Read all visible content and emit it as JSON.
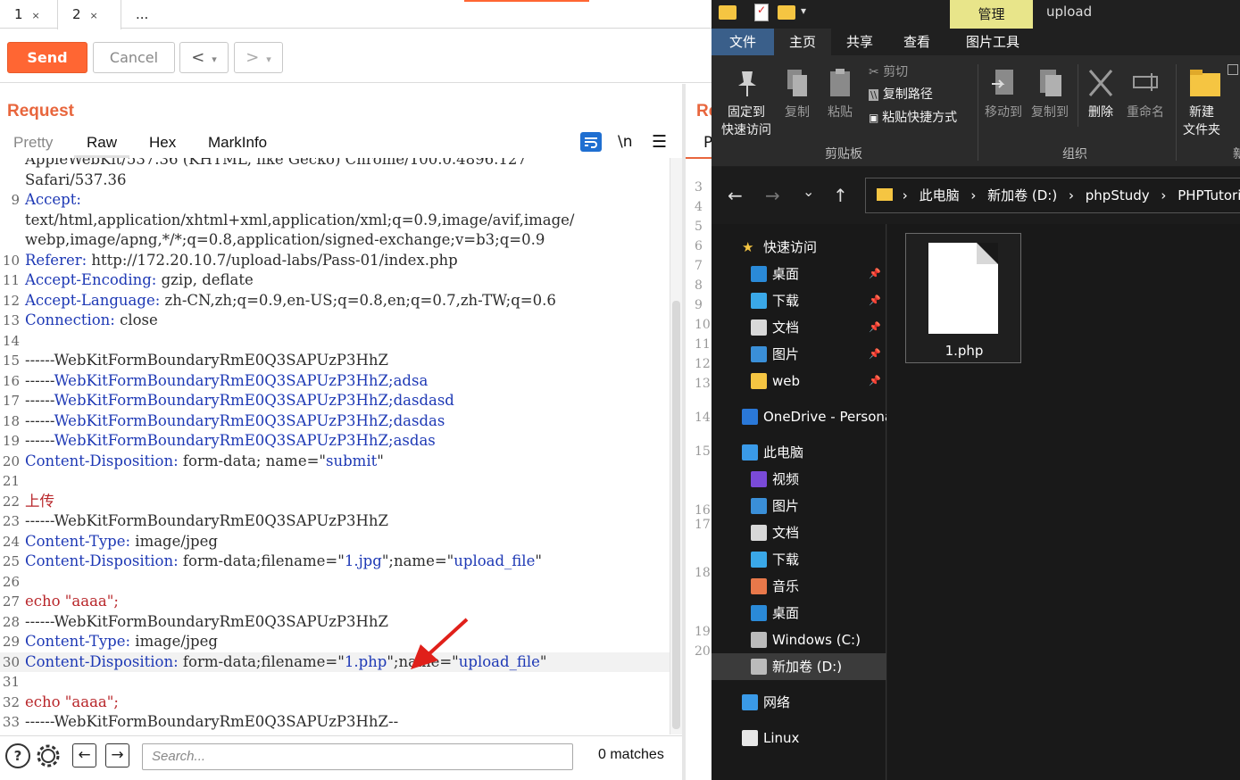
{
  "burp": {
    "tabs": [
      "1",
      "2",
      "..."
    ],
    "tab_close": "×",
    "buttons": {
      "send": "Send",
      "cancel": "Cancel",
      "back": "<",
      "forward": ">",
      "dropdown": "▾"
    },
    "request_title": "Request",
    "response_title": "Re",
    "view_tabs": [
      "Pretty",
      "Raw",
      "Hex",
      "MarkInfo"
    ],
    "newline_toggle": "\\n",
    "lines": [
      {
        "n": "",
        "parts": [
          [
            "v",
            "AppleWebKit/537.36 (KHTML, like Gecko) Chrome/100.0.4896.127"
          ]
        ]
      },
      {
        "n": "",
        "parts": [
          [
            "v",
            "Safari/537.36"
          ]
        ]
      },
      {
        "n": "9",
        "parts": [
          [
            "k",
            "Accept:"
          ]
        ]
      },
      {
        "n": "",
        "parts": [
          [
            "v",
            "text/html,application/xhtml+xml,application/xml;q=0.9,image/avif,image/"
          ]
        ]
      },
      {
        "n": "",
        "parts": [
          [
            "v",
            "webp,image/apng,*/*;q=0.8,application/signed-exchange;v=b3;q=0.9"
          ]
        ]
      },
      {
        "n": "10",
        "parts": [
          [
            "k",
            "Referer:"
          ],
          [
            "v",
            " http://172.20.10.7/upload-labs/Pass-01/index.php"
          ]
        ]
      },
      {
        "n": "11",
        "parts": [
          [
            "k",
            "Accept-Encoding:"
          ],
          [
            "v",
            " gzip, deflate"
          ]
        ]
      },
      {
        "n": "12",
        "parts": [
          [
            "k",
            "Accept-Language:"
          ],
          [
            "v",
            " zh-CN,zh;q=0.9,en-US;q=0.8,en;q=0.7,zh-TW;q=0.6"
          ]
        ]
      },
      {
        "n": "13",
        "parts": [
          [
            "k",
            "Connection:"
          ],
          [
            "v",
            " close"
          ]
        ]
      },
      {
        "n": "14",
        "parts": []
      },
      {
        "n": "15",
        "parts": [
          [
            "v",
            "------WebKitFormBoundaryRmE0Q3SAPUzP3HhZ"
          ]
        ]
      },
      {
        "n": "16",
        "parts": [
          [
            "v",
            "------"
          ],
          [
            "k",
            "WebKitFormBoundaryRmE0Q3SAPUzP3HhZ;adsa"
          ]
        ]
      },
      {
        "n": "17",
        "parts": [
          [
            "v",
            "------"
          ],
          [
            "k",
            "WebKitFormBoundaryRmE0Q3SAPUzP3HhZ;dasdasd"
          ]
        ]
      },
      {
        "n": "18",
        "parts": [
          [
            "v",
            "------"
          ],
          [
            "k",
            "WebKitFormBoundaryRmE0Q3SAPUzP3HhZ;dasdas"
          ]
        ]
      },
      {
        "n": "19",
        "parts": [
          [
            "v",
            "------"
          ],
          [
            "k",
            "WebKitFormBoundaryRmE0Q3SAPUzP3HhZ;asdas"
          ]
        ]
      },
      {
        "n": "20",
        "parts": [
          [
            "k",
            "Content-Disposition:"
          ],
          [
            "v",
            " form-data; name=\""
          ],
          [
            "k",
            "submit"
          ],
          [
            "v",
            "\""
          ]
        ]
      },
      {
        "n": "21",
        "parts": []
      },
      {
        "n": "22",
        "parts": [
          [
            "r",
            "上传"
          ]
        ]
      },
      {
        "n": "23",
        "parts": [
          [
            "v",
            "------WebKitFormBoundaryRmE0Q3SAPUzP3HhZ"
          ]
        ]
      },
      {
        "n": "24",
        "parts": [
          [
            "k",
            "Content-Type:"
          ],
          [
            "v",
            " image/jpeg"
          ]
        ]
      },
      {
        "n": "25",
        "parts": [
          [
            "k",
            "Content-Disposition:"
          ],
          [
            "v",
            " form-data;filename=\""
          ],
          [
            "k",
            "1.jpg"
          ],
          [
            "v",
            "\";name=\""
          ],
          [
            "k",
            "upload_file"
          ],
          [
            "v",
            "\""
          ]
        ]
      },
      {
        "n": "26",
        "parts": []
      },
      {
        "n": "27",
        "parts": [
          [
            "r",
            "echo \"aaaa\";"
          ]
        ]
      },
      {
        "n": "28",
        "parts": [
          [
            "v",
            "------WebKitFormBoundaryRmE0Q3SAPUzP3HhZ"
          ]
        ]
      },
      {
        "n": "29",
        "parts": [
          [
            "k",
            "Content-Type:"
          ],
          [
            "v",
            " image/jpeg"
          ]
        ]
      },
      {
        "n": "30",
        "parts": [
          [
            "k",
            "Content-Disposition:"
          ],
          [
            "v",
            " form-data;filename=\""
          ],
          [
            "k",
            "1.php"
          ],
          [
            "v",
            "\";name=\""
          ],
          [
            "k",
            "upload_file"
          ],
          [
            "v",
            "\""
          ]
        ],
        "highlight": true
      },
      {
        "n": "31",
        "parts": []
      },
      {
        "n": "32",
        "parts": [
          [
            "r",
            "echo \"aaaa\";"
          ]
        ]
      },
      {
        "n": "33",
        "parts": [
          [
            "v",
            "------WebKitFormBoundaryRmE0Q3SAPUzP3HhZ--"
          ]
        ]
      }
    ],
    "response_line_numbers": [
      "3",
      "4",
      "5",
      "6",
      "7",
      "8",
      "9",
      "10",
      "11",
      "12",
      "13",
      "14",
      "15",
      "16",
      "17",
      "18",
      "19",
      "20"
    ],
    "search_placeholder": "Search...",
    "matches": "0 matches",
    "accent_color": "#ff6633"
  },
  "explorer": {
    "context_tab": "管理",
    "window_title": "upload",
    "ribbon_tabs": [
      "文件",
      "主页",
      "共享",
      "查看",
      "图片工具"
    ],
    "ribbon": {
      "pin": "固定到\n快速访问",
      "copy": "复制",
      "paste": "粘贴",
      "cut": "剪切",
      "copy_path": "复制路径",
      "paste_shortcut": "粘贴快捷方式",
      "move_to": "移动到",
      "copy_to": "复制到",
      "delete": "删除",
      "rename": "重命名",
      "new_folder": "新建\n文件夹",
      "group_clipboard": "剪贴板",
      "group_organize": "组织",
      "group_new": "新"
    },
    "path": [
      "此电脑",
      "新加卷 (D:)",
      "phpStudy",
      "PHPTutorial"
    ],
    "path_sep": "›",
    "nav": {
      "back": "←",
      "forward": "→",
      "recent": "⌄",
      "up": "↑"
    },
    "tree": [
      {
        "label": "快速访问",
        "icon": "star-icon",
        "level": 0
      },
      {
        "label": "桌面",
        "icon": "desktop-icon",
        "level": 1,
        "pinned": true
      },
      {
        "label": "下载",
        "icon": "download-icon",
        "level": 1,
        "pinned": true
      },
      {
        "label": "文档",
        "icon": "document-icon",
        "level": 1,
        "pinned": true
      },
      {
        "label": "图片",
        "icon": "picture-icon",
        "level": 1,
        "pinned": true
      },
      {
        "label": "web",
        "icon": "folder-icon",
        "level": 1,
        "pinned": true
      },
      {
        "label": "OneDrive - Persona",
        "icon": "cloud-icon",
        "level": 0
      },
      {
        "label": "此电脑",
        "icon": "computer-icon",
        "level": 0
      },
      {
        "label": "视频",
        "icon": "video-icon",
        "level": 1
      },
      {
        "label": "图片",
        "icon": "picture-icon",
        "level": 1
      },
      {
        "label": "文档",
        "icon": "document-icon",
        "level": 1
      },
      {
        "label": "下载",
        "icon": "download-icon",
        "level": 1
      },
      {
        "label": "音乐",
        "icon": "music-icon",
        "level": 1
      },
      {
        "label": "桌面",
        "icon": "desktop-icon",
        "level": 1
      },
      {
        "label": "Windows (C:)",
        "icon": "drive-icon",
        "level": 1
      },
      {
        "label": "新加卷 (D:)",
        "icon": "drive-icon",
        "level": 1,
        "selected": true
      },
      {
        "label": "网络",
        "icon": "network-icon",
        "level": 0
      },
      {
        "label": "Linux",
        "icon": "linux-icon",
        "level": 0
      }
    ],
    "files": [
      {
        "name": "1.php",
        "icon": "file-icon"
      }
    ],
    "pin_glyph": "📌"
  }
}
